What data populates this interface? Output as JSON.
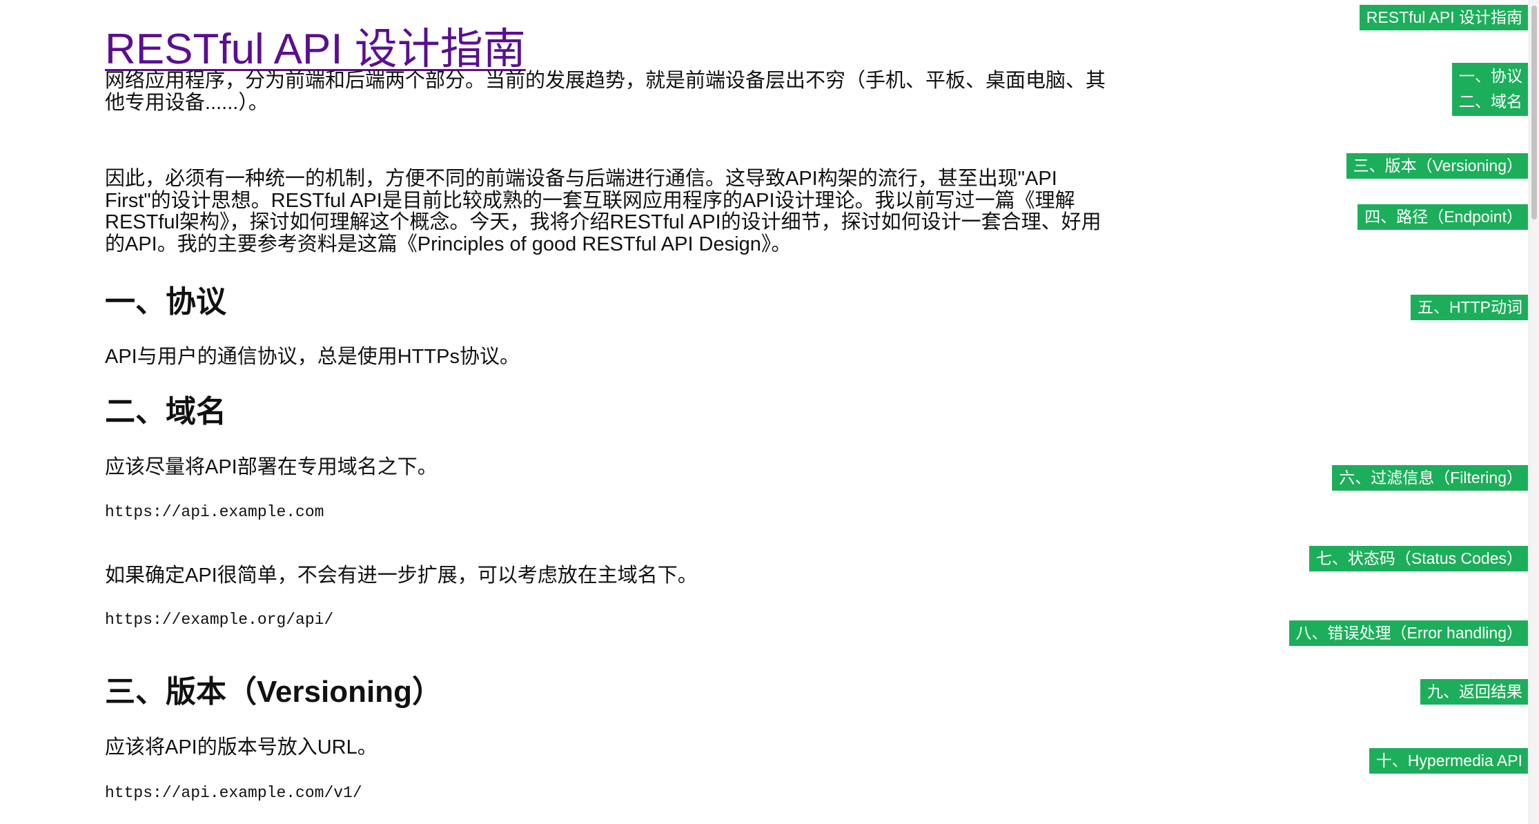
{
  "title": "RESTful API 设计指南",
  "intro": {
    "p1": [
      "网络应用程序，分为前端和后端两个部分。当前的发展趋势，就是前端设备层出不穷（手机、平板、桌面电脑、其",
      "他专用设备......）。"
    ],
    "p2": [
      "因此，必须有一种统一的机制，方便不同的前端设备与后端进行通信。这导致API构架的流行，甚至出现\"API",
      "First\"的设计思想。RESTful API是目前比较成熟的一套互联网应用程序的API设计理论。我以前写过一篇《理解",
      "RESTful架构》，探讨如何理解这个概念。今天，我将介绍RESTful API的设计细节，探讨如何设计一套合理、好用",
      "的API。我的主要参考资料是这篇《Principles of good RESTful API Design》。"
    ]
  },
  "sections": {
    "s1": {
      "heading": "一、协议",
      "text": "API与用户的通信协议，总是使用HTTPs协议。"
    },
    "s2": {
      "heading": "二、域名",
      "text1": "应该尽量将API部署在专用域名之下。",
      "code1": "https://api.example.com",
      "text2": "如果确定API很简单，不会有进一步扩展，可以考虑放在主域名下。",
      "code2": "https://example.org/api/"
    },
    "s3": {
      "heading": "三、版本（Versioning）",
      "text": "应该将API的版本号放入URL。",
      "code": "https://api.example.com/v1/"
    }
  },
  "toc": {
    "top": "RESTful API 设计指南",
    "i1": "一、协议",
    "i2": "二、域名",
    "i3": "三、版本（Versioning）",
    "i4": "四、路径（Endpoint）",
    "i5": "五、HTTP动词",
    "i6": "六、过滤信息（Filtering）",
    "i7": "七、状态码（Status Codes）",
    "i8": "八、错误处理（Error handling）",
    "i9": "九、返回结果",
    "i10": "十、Hypermedia API"
  },
  "colors": {
    "title": "#5a0f91",
    "toc_bg": "#1dae5b"
  }
}
